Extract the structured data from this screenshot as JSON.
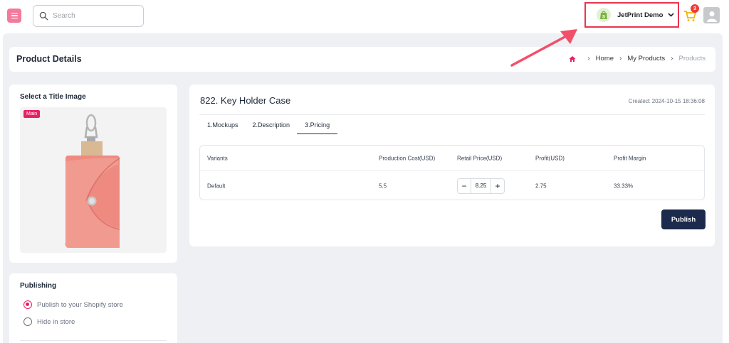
{
  "topbar": {
    "search_placeholder": "Search",
    "store_name": "JetPrint Demo",
    "cart_count": "3"
  },
  "header": {
    "title": "Product Details",
    "breadcrumb": [
      "Home",
      "My Products",
      "Products"
    ]
  },
  "image_panel": {
    "title": "Select a Title Image",
    "badge": "Main"
  },
  "product": {
    "title": "822. Key Holder Case",
    "created": "Created: 2024-10-15 18:36:08",
    "tabs": [
      "1.Mockups",
      "2.Description",
      "3.Pricing"
    ],
    "active_tab": "3.Pricing"
  },
  "pricing_table": {
    "headers": [
      "Variants",
      "Production Cost(USD)",
      "Retail Price(USD)",
      "Profit(USD)",
      "Profit Margin"
    ],
    "rows": [
      {
        "variant": "Default",
        "production_cost": "5.5",
        "retail_price": "8.25",
        "profit": "2.75",
        "margin": "33.33%"
      }
    ],
    "minus": "−",
    "plus": "+"
  },
  "publish_button": "Publish",
  "publishing": {
    "title": "Publishing",
    "options": [
      "Publish to your Shopify store",
      "Hide in store"
    ],
    "selected": "Publish to your Shopify store"
  },
  "colors": {
    "accent": "#e91e63",
    "navy": "#1c2a4d",
    "highlight_border": "#e8344e",
    "product_pink": "#ef8a80"
  }
}
